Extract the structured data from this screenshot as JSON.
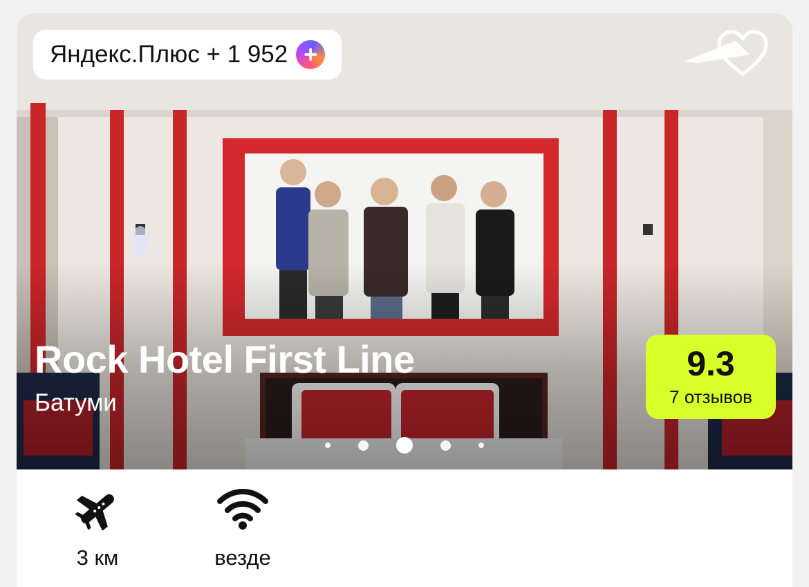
{
  "plus_badge": {
    "label": "Яндекс.Плюс + 1 952",
    "icon": "yandex-plus-icon"
  },
  "favorite": {
    "icon": "heart-icon"
  },
  "hotel": {
    "name": "Rock Hotel First Line",
    "city": "Батуми"
  },
  "rating": {
    "score": "9.3",
    "reviews": "7 отзывов",
    "color": "#d8ff2a"
  },
  "carousel": {
    "total": 5,
    "active": 3
  },
  "amenities": [
    {
      "icon": "airplane-icon",
      "label": "3 км"
    },
    {
      "icon": "wifi-icon",
      "label": "везде"
    }
  ]
}
